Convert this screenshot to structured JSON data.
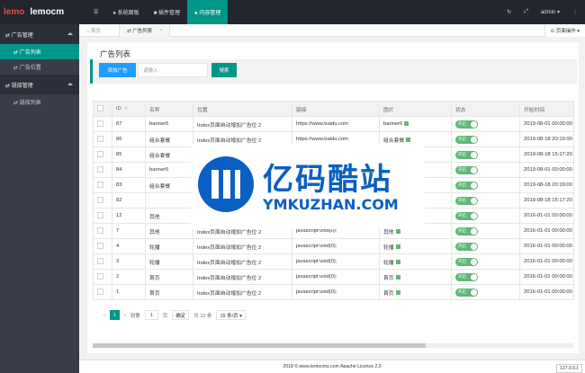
{
  "app": {
    "logo_red": "lemo",
    "logo_white": "lemocm"
  },
  "top_nav": [
    {
      "label": "☰",
      "active": false
    },
    {
      "label": "● 系统面板",
      "active": false
    },
    {
      "label": "■ 插件管理",
      "active": false
    },
    {
      "label": "● 内容管理",
      "active": true
    }
  ],
  "top_right": {
    "refresh": "↻",
    "fullscreen": "⤢",
    "user": "admin ▾",
    "more": "⋮"
  },
  "sidebar": {
    "groups": [
      {
        "label": "⇄ 广告管理",
        "items": [
          {
            "label": "⇄ 广告列表",
            "active": true
          },
          {
            "label": "⇄ 广告位置",
            "active": false
          }
        ]
      },
      {
        "label": "⇄ 链接管理",
        "items": [
          {
            "label": "⇄ 链接列表",
            "active": false
          }
        ]
      }
    ]
  },
  "tabs": {
    "home": "⌂ 首页",
    "current": "⇄ 广告列表",
    "close": "×",
    "page_ops": "⊙ 页面操作 ▾"
  },
  "main": {
    "title": "广告列表",
    "add_button": "添加广告",
    "search_placeholder": "请输入",
    "search_button": "搜索"
  },
  "table": {
    "headers": [
      "",
      "ID",
      "名称",
      "位置",
      "链接",
      "图片",
      "状态",
      "开始时间"
    ],
    "rows": [
      {
        "id": "87",
        "name": "banner6",
        "position": "Index页面自动增加广告位 2",
        "link": "https://www.baidu.com",
        "image": "banner6",
        "status": "开启",
        "start": "2019-08-01 00:00:00"
      },
      {
        "id": "86",
        "name": "组合套餐",
        "position": "Index页面自动增加广告位 2",
        "link": "https://www.baidu.com",
        "image": "组合套餐",
        "status": "开启",
        "start": "2019-08-18 20:19:00"
      },
      {
        "id": "85",
        "name": "组合套餐",
        "position": "",
        "link": "",
        "image": "套餐",
        "status": "开启",
        "start": "2019-08-18 15:17:20"
      },
      {
        "id": "84",
        "name": "banner5",
        "position": "",
        "link": "",
        "image": "er5",
        "status": "开启",
        "start": "2019-08-01 00:00:00"
      },
      {
        "id": "83",
        "name": "组合套餐",
        "position": "",
        "link": "",
        "image": "套餐",
        "status": "开启",
        "start": "2019-08-18 20:19:00"
      },
      {
        "id": "82",
        "name": "",
        "position": "",
        "link": "",
        "image": "",
        "status": "开启",
        "start": "2019-08-18 15:17:20"
      },
      {
        "id": "12",
        "name": "其他",
        "position": "",
        "link": "",
        "image": "",
        "status": "开启",
        "start": "2016-01-01 00:00:00"
      },
      {
        "id": "7",
        "name": "其他",
        "position": "Index页面自动增加广告位 2",
        "link": "javascript:void(0);",
        "image": "其他",
        "status": "开启",
        "start": "2016-01-01 00:00:00"
      },
      {
        "id": "4",
        "name": "轮播",
        "position": "Index页面自动增加广告位 2",
        "link": "javascript:void(0);",
        "image": "轮播",
        "status": "开启",
        "start": "2016-01-01 00:00:00"
      },
      {
        "id": "3",
        "name": "轮播",
        "position": "Index页面自动增加广告位 2",
        "link": "javascript:void(0);",
        "image": "轮播",
        "status": "开启",
        "start": "2016-01-01 00:00:00"
      },
      {
        "id": "2",
        "name": "首页",
        "position": "Index页面自动增加广告位 2",
        "link": "javascript:void(0);",
        "image": "首页",
        "status": "开启",
        "start": "2016-01-01 00:00:00"
      },
      {
        "id": "1",
        "name": "首页",
        "position": "Index页面自动增加广告位 2",
        "link": "javascript:void(0);",
        "image": "首页",
        "status": "开启",
        "start": "2016-01-01 00:00:00"
      }
    ]
  },
  "pager": {
    "prev": "‹",
    "current": "1",
    "next": "›",
    "goto": "到第",
    "page_input": "1",
    "page_unit": "页",
    "confirm": "确定",
    "total": "共 12 条",
    "per_page": "15 条/页 ▾"
  },
  "footer": {
    "copyright": "2018 © www.lemocms.com Apache Licence 2.0",
    "version": "127.0.0.1"
  },
  "watermark": {
    "cn": "亿码酷站",
    "en": "YMKUZHAN.COM"
  }
}
